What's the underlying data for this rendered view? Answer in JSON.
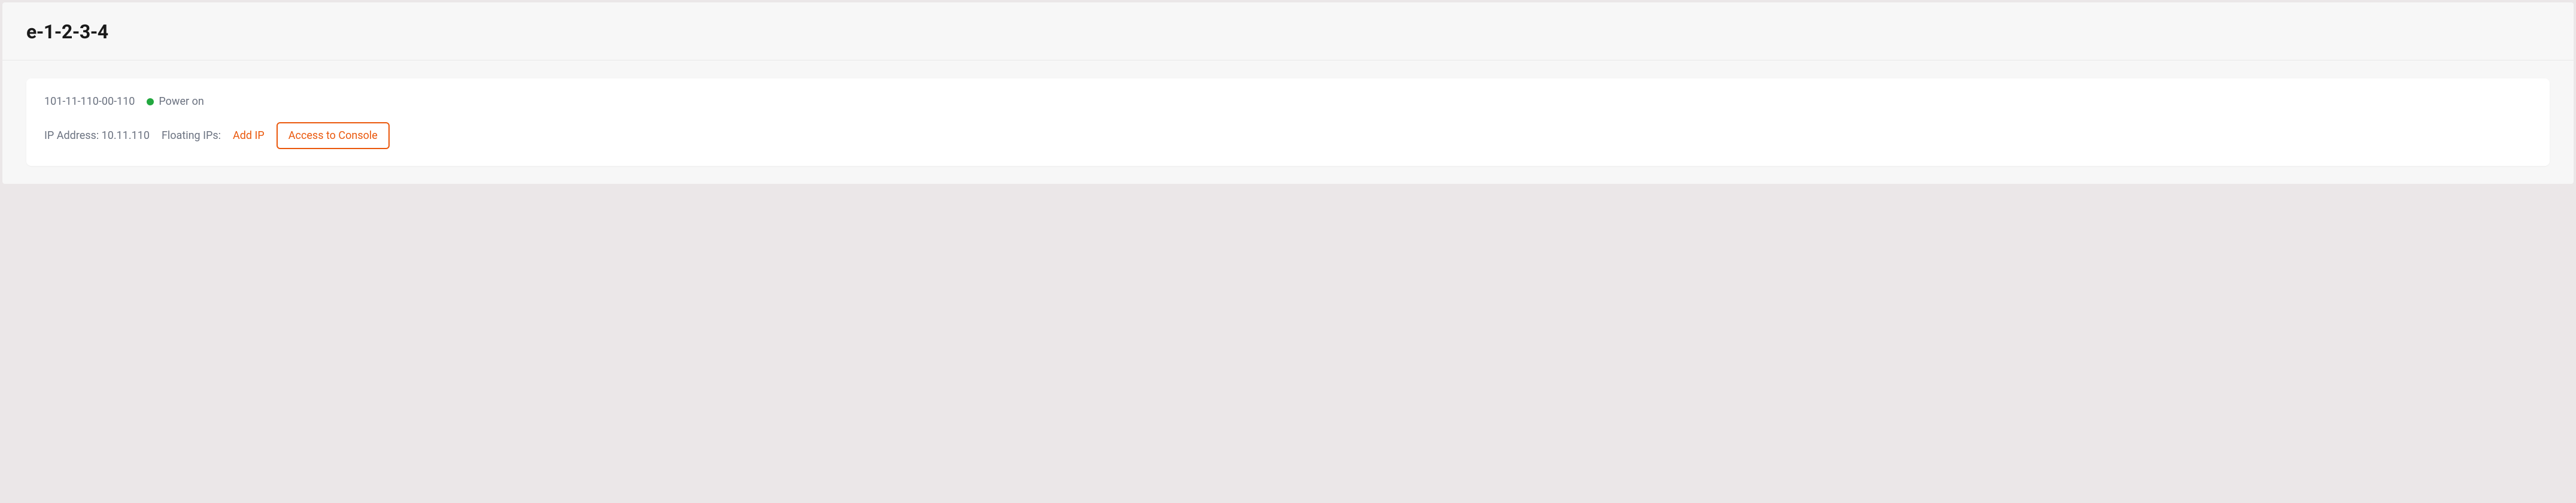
{
  "header": {
    "title": "e-1-2-3-4"
  },
  "card": {
    "machine_id": "101-11-110-00-110",
    "status": {
      "label": "Power on",
      "color": "#22a83f"
    },
    "ip_address_label": "IP Address: 10.11.110",
    "floating_ips_label": "Floating IPs:",
    "add_ip_label": "Add IP",
    "console_button_label": "Access to Console"
  }
}
